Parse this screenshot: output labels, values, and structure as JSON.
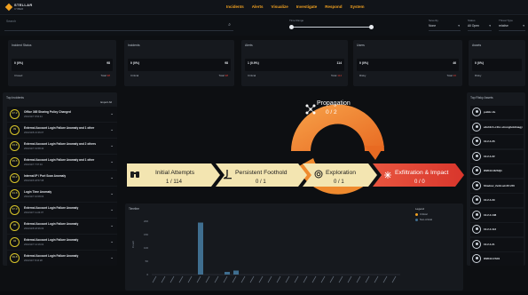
{
  "app": {
    "logo_name": "STELLAR",
    "logo_sub": "CYBER",
    "nav": [
      "Incidents",
      "Alerts",
      "Visualize",
      "Investigate",
      "Respond",
      "System"
    ]
  },
  "filters": {
    "search_placeholder": "Search",
    "time_range_label": "Time Range",
    "time_range_start": "",
    "time_range_end": "",
    "severity_label": "Severity",
    "severity_value": "None",
    "status_label": "Status",
    "status_value": "All Open",
    "threat_type_label": "Threat Type",
    "threat_type_value": "relative"
  },
  "stats": [
    {
      "title": "Incident Status",
      "main_left": "0 (0%)",
      "main_right": "98",
      "sub_left": "Closed",
      "sub_right_prefix": "Total",
      "sub_right_value": "98"
    },
    {
      "title": "Incidents",
      "main_left": "0 (0%)",
      "main_right": "98",
      "sub_left": "Critical",
      "sub_right_prefix": "Total",
      "sub_right_value": "98"
    },
    {
      "title": "Alerts",
      "main_left": "1 (0.9%)",
      "main_right": "114",
      "sub_left": "Critical",
      "sub_right_prefix": "Total",
      "sub_right_value": "114"
    },
    {
      "title": "Users",
      "main_left": "0 (0%)",
      "main_right": "46",
      "sub_left": "Risky",
      "sub_right_prefix": "Total",
      "sub_right_value": "46"
    },
    {
      "title": "Assets",
      "main_left": "0 (0%)",
      "main_right": "",
      "sub_left": "Risky",
      "sub_right_prefix": "",
      "sub_right_value": ""
    }
  ],
  "top_incidents": {
    "title": "Top Incidents",
    "export_label": "Export All",
    "items": [
      {
        "score": "47.2",
        "title": "Office 365 Sharing Policy Changed",
        "date": "2024/11/7 9:54:44"
      },
      {
        "score": "39",
        "title": "External Account Login Failure Anomaly and 1 other",
        "date": "2024/11/8 21:36:07"
      },
      {
        "score": "43.6",
        "title": "External Account Login Failure Anomaly and 2 others",
        "date": "2024/11/7 19:58:40"
      },
      {
        "score": "35.5",
        "title": "External Account Login Failure Anomaly and 1 other",
        "date": "2024/11/7 7:07:34"
      },
      {
        "score": "36.2",
        "title": "Internal IP / Port Scan Anomaly",
        "date": "2024/11/6 18:57:08"
      },
      {
        "score": "31.6",
        "title": "Login Time Anomaly",
        "date": "2024/11/7 10:08:03"
      },
      {
        "score": "37.3",
        "title": "External Account Login Failure Anomaly",
        "date": "2024/11/7 11:24:07"
      },
      {
        "score": "30",
        "title": "External Account Login Failure Anomaly",
        "date": "2024/11/8 18:36:03"
      },
      {
        "score": "32",
        "title": "External Account Login Failure Anomaly",
        "date": "2024/11/7 14:16:02"
      },
      {
        "score": "39.8",
        "title": "External Account Login Failure Anomaly",
        "date": "2024/11/7 8:16:28"
      }
    ]
  },
  "top_assets": {
    "title": "Top Risky Assets",
    "items": [
      "public-tls",
      "e2e12c1-c41c-strongholdmagyar",
      "10.2.4.26",
      "10.2.4.22",
      "W2K12-R2SQ1",
      "Shadow_2e4d-ad-20:c50",
      "10.2.4.29",
      "10.2.4.108",
      "10.2.4.113",
      "10.2.4.21",
      "W2K12-FS01"
    ]
  },
  "kill_chain": {
    "stages": [
      {
        "name": "Initial Attempts",
        "value": "1 / 114",
        "icon": "binoculars-icon"
      },
      {
        "name": "Persistent Foothold",
        "value": "0 / 1",
        "icon": "hook-icon"
      },
      {
        "name": "Exploration",
        "value": "0 / 1",
        "icon": "target-icon"
      },
      {
        "name": "Exfiltration & Impact",
        "value": "0 / 0",
        "icon": "burst-icon"
      }
    ],
    "propagation": {
      "name": "Propagation",
      "value": "0 / 2",
      "icon": "network-icon"
    },
    "colors": {
      "stage_fill": "#f3e5b1",
      "propagation": "#f08a2c",
      "exfiltration": "#e5533d"
    }
  },
  "timeline": {
    "title": "Timeline",
    "legend_title": "Legend",
    "legend": [
      {
        "name": "Critical",
        "color": "#f0a020"
      },
      {
        "name": "Non-critical",
        "color": "#3f6e8f"
      }
    ]
  },
  "chart_data": {
    "type": "bar",
    "ylabel": "Count",
    "yticks": [
      0,
      50,
      100,
      150,
      200
    ],
    "ylim": [
      0,
      220
    ],
    "values": [
      0,
      0,
      0,
      0,
      0,
      195,
      0,
      0,
      10,
      15,
      0,
      0,
      0,
      0,
      0,
      0,
      0,
      0,
      0,
      0,
      0,
      0,
      0,
      0,
      0,
      0,
      0,
      0
    ],
    "bar_color": "#3f6e8f"
  }
}
